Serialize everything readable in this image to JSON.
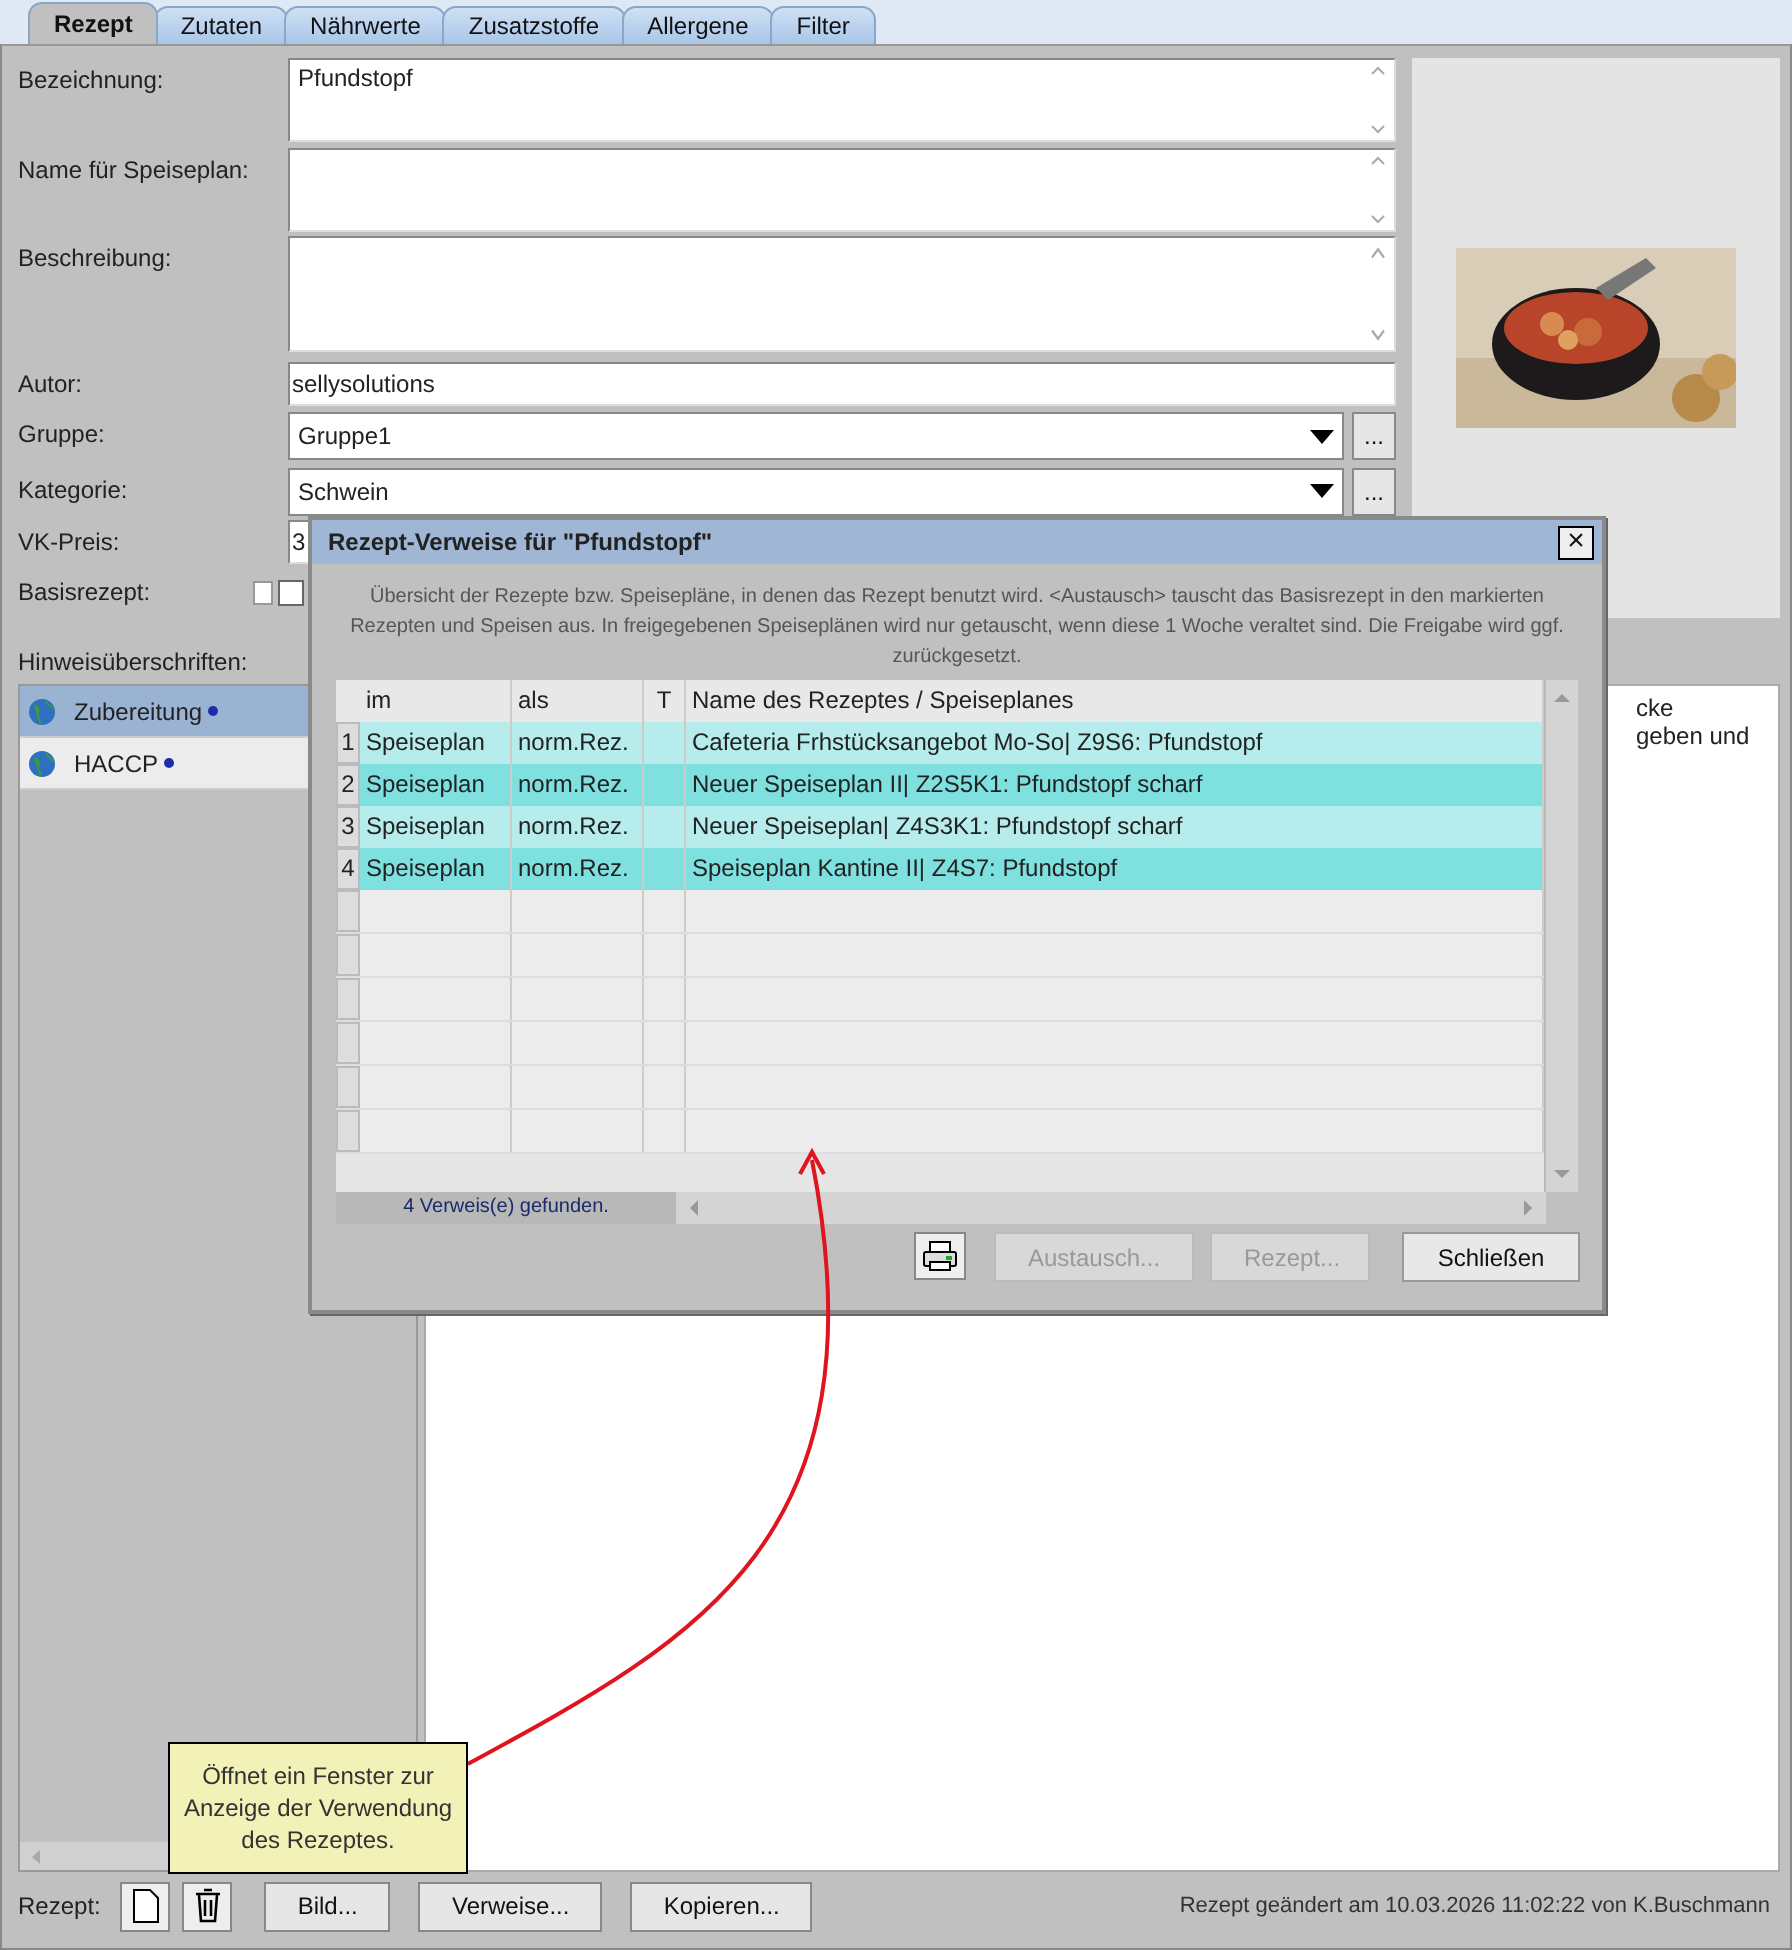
{
  "tabs": [
    {
      "label": "Rezept",
      "selected": true
    },
    {
      "label": "Zutaten",
      "selected": false
    },
    {
      "label": "Nährwerte",
      "selected": false
    },
    {
      "label": "Zusatzstoffe",
      "selected": false
    },
    {
      "label": "Allergene",
      "selected": false
    },
    {
      "label": "Filter",
      "selected": false
    }
  ],
  "form": [
    {
      "kind": "textarea",
      "label": "Bezeichnung:",
      "value": "Pfundstopf"
    },
    {
      "kind": "textarea",
      "label": "Name für Speiseplan:"
    },
    {
      "kind": "textarea_tall",
      "label": "Beschreibung:"
    },
    {
      "kind": "input",
      "label": "Autor:",
      "value": "sellysolutions"
    },
    {
      "kind": "combo",
      "label": "Gruppe:",
      "value": "Gruppe1",
      "button": "..."
    },
    {
      "kind": "combo",
      "label": "Kategorie:",
      "value": "Schwein",
      "button": "..."
    },
    {
      "kind": "input",
      "label": "VK-Preis:",
      "value": "3"
    },
    {
      "kind": "checkbox",
      "label": "Basisrezept:",
      "checked": false
    }
  ],
  "hints": {
    "label": "Hinweisüberschriften:",
    "items": [
      {
        "label": "Zubereitung",
        "selected": true
      },
      {
        "label": "HACCP",
        "selected": false
      }
    ],
    "text_lines": [
      "cke",
      "geben und"
    ]
  },
  "dialog": {
    "title": "Rezept-Verweise für \"Pfundstopf\"",
    "close": "×",
    "description": "Übersicht der Rezepte bzw. Speisepläne, in denen das Rezept benutzt wird. <Austausch> tauscht das Basisrezept in den markierten Rezepten und Speisen aus. In freigegebenen Speiseplänen wird nur getauscht, wenn diese 1 Woche veraltet sind. Die Freigabe wird ggf. zurückgesetzt.",
    "columns": [
      "im",
      "als",
      "T",
      "Name des Rezeptes / Speiseplanes"
    ],
    "rows": [
      {
        "num": "1",
        "cells": [
          "Speiseplan",
          "norm.Rez.",
          "",
          "Cafeteria Frhstücksangebot Mo-So| Z9S6: Pfundstopf"
        ]
      },
      {
        "num": "2",
        "cells": [
          "Speiseplan",
          "norm.Rez.",
          "",
          "Neuer Speiseplan II| Z2S5K1: Pfundstopf scharf"
        ]
      },
      {
        "num": "3",
        "cells": [
          "Speiseplan",
          "norm.Rez.",
          "",
          "Neuer Speiseplan| Z4S3K1: Pfundstopf scharf"
        ]
      },
      {
        "num": "4",
        "cells": [
          "Speiseplan",
          "norm.Rez.",
          "",
          "Speiseplan Kantine II| Z4S7: Pfundstopf"
        ]
      }
    ],
    "status": "4  Verweis(e) gefunden.",
    "buttons": [
      {
        "kind": "print"
      },
      {
        "kind": "text",
        "label": "Austausch...",
        "disabled": true
      },
      {
        "kind": "text",
        "label": "Rezept...",
        "disabled": true
      },
      {
        "kind": "text",
        "label": "Schließen",
        "disabled": false
      }
    ]
  },
  "tooltip": "Öffnet ein Fenster zur Anzeige der Verwendung des Rezeptes.",
  "bottom_bar": {
    "label": "Rezept:",
    "buttons": [
      {
        "kind": "new"
      },
      {
        "kind": "delete"
      },
      {
        "kind": "text",
        "label": "Bild..."
      },
      {
        "kind": "text",
        "label": "Verweise..."
      },
      {
        "kind": "text",
        "label": "Kopieren..."
      }
    ],
    "status": "Rezept geändert am 10.03.2026 11:02:22 von K.Buschmann"
  }
}
